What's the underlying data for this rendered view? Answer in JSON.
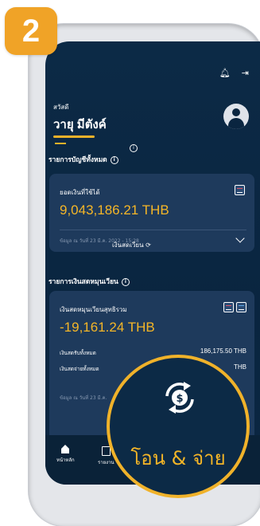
{
  "step": {
    "number": "2"
  },
  "header": {
    "bell_icon": "bell-icon",
    "logout_icon": "logout-icon"
  },
  "user": {
    "greeting": "สวัสดี",
    "name": "วายุ มีตังค์"
  },
  "accounts_section": {
    "title": "รายการบัญชีทั้งหมด"
  },
  "available_card": {
    "label": "ยอดเงินที่ใช้ได้",
    "amount": "9,043,186.21 THB",
    "date": "ข้อมูล ณ วันที่ 23 มี.ค. 2022 - 15:28"
  },
  "revolving_section": {
    "label": "เงินสดเวียน",
    "title": "รายการเงินสดหมุนเวียน"
  },
  "revolving_card": {
    "label": "เงินสดหมุนเวียนสุทธิรวม",
    "amount": "-19,161.24 THB",
    "rows": [
      {
        "label": "เงินสดรับทั้งหมด",
        "value": "186,175.50 THB"
      },
      {
        "label": "เงินสดจ่ายทั้งหมด",
        "value": "THB"
      }
    ],
    "date": "ข้อมูล ณ วันที่ 23 มี.ค."
  },
  "bottom_nav": {
    "home": "หน้าหลัก",
    "reports": "รายงาน"
  },
  "highlight": {
    "label": "โอน & จ่าย",
    "icon": "transfer-pay-icon"
  },
  "colors": {
    "accent": "#f0b22a",
    "navy": "#0a2540",
    "card": "#1e3a5c",
    "badge": "#f0a327"
  }
}
